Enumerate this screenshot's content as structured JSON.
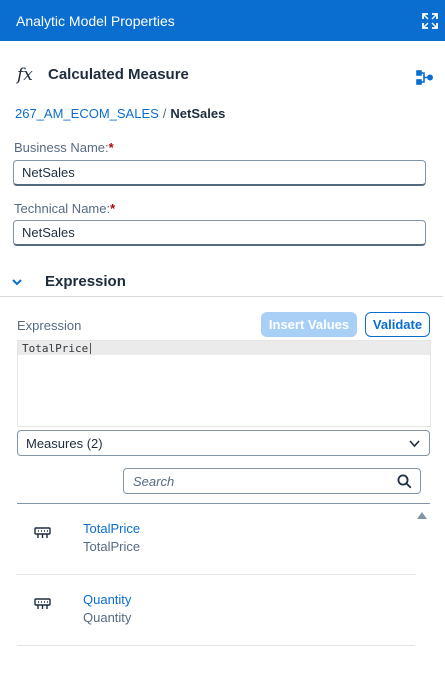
{
  "window": {
    "title": "Analytic Model Properties",
    "expand_icon": "expand-icon"
  },
  "panel": {
    "fx_symbol": "fx",
    "title": "Calculated Measure",
    "graph_icon": "graph-icon"
  },
  "breadcrumb": {
    "parent": "267_AM_ECOM_SALES",
    "separator": "/",
    "current": "NetSales"
  },
  "business_name": {
    "label": "Business Name:",
    "required_mark": "*",
    "value": "NetSales"
  },
  "technical_name": {
    "label": "Technical Name:",
    "required_mark": "*",
    "value": "NetSales"
  },
  "expression_section": {
    "title": "Expression",
    "label": "Expression",
    "insert_values_label": "Insert Values",
    "validate_label": "Validate",
    "code": "TotalPrice"
  },
  "measures_select": {
    "value": "Measures (2)"
  },
  "search": {
    "placeholder": "Search"
  },
  "measures": [
    {
      "name": "TotalPrice",
      "description": "TotalPrice",
      "icon": "measure-icon"
    },
    {
      "name": "Quantity",
      "description": "Quantity",
      "icon": "measure-icon"
    }
  ],
  "colors": {
    "brand": "#0a6ed1",
    "text": "#1d2d3e",
    "secondary": "#556b82",
    "required": "#aa0808",
    "disabled_button": "#a8cff5"
  }
}
